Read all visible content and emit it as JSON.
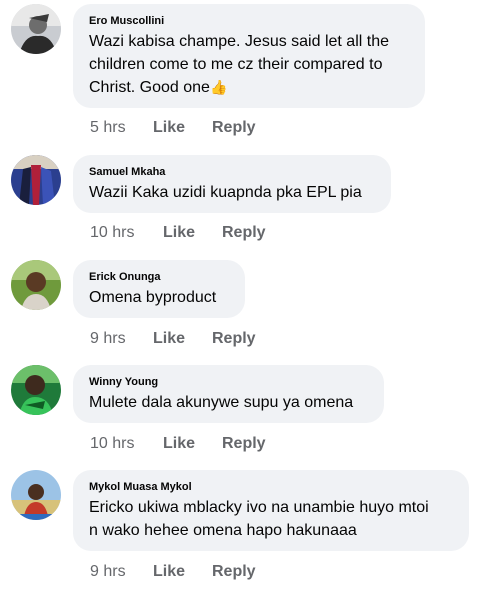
{
  "comments": [
    {
      "author": "Ero Muscollini",
      "lines": [
        "Wazi kabisa champe. Jesus said let all the",
        "children come to me cz their compared to",
        "Christ. Good one"
      ],
      "emoji": "👍",
      "time": "5 hrs",
      "like": "Like",
      "reply": "Reply",
      "avatar_icon": "profile-photo"
    },
    {
      "author": "Samuel Mkaha",
      "lines": [
        "Wazii Kaka uzidi kuapnda pka EPL pia"
      ],
      "time": "10 hrs",
      "like": "Like",
      "reply": "Reply",
      "avatar_icon": "profile-photo"
    },
    {
      "author": "Erick Onunga",
      "lines": [
        "Omena byproduct"
      ],
      "time": "9 hrs",
      "like": "Like",
      "reply": "Reply",
      "avatar_icon": "profile-photo"
    },
    {
      "author": "Winny Young",
      "lines": [
        "Mulete dala akunywe supu ya omena"
      ],
      "time": "10 hrs",
      "like": "Like",
      "reply": "Reply",
      "avatar_icon": "profile-photo"
    },
    {
      "author": "Mykol Muasa Mykol",
      "lines": [
        "Ericko ukiwa mblacky ivo na unambie huyo mtoi",
        "n wako hehee omena hapo hakunaaa"
      ],
      "time": "9 hrs",
      "like": "Like",
      "reply": "Reply",
      "avatar_icon": "profile-photo"
    }
  ],
  "colors": {
    "bubble": "#f0f2f5",
    "secondary_text": "#65676b",
    "primary_text": "#050505"
  }
}
